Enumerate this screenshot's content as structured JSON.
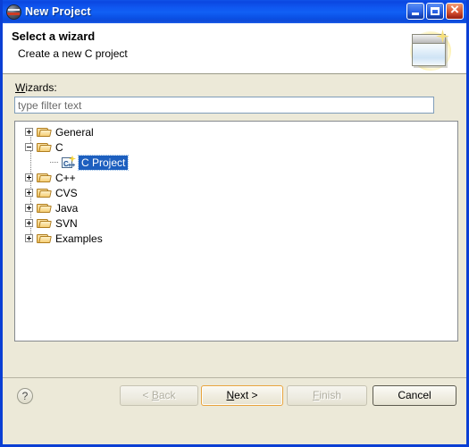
{
  "window": {
    "title": "New Project",
    "app_icon": "eclipse-sphere-icon",
    "controls": {
      "minimize": "minimize-icon",
      "maximize": "maximize-icon",
      "close": "close-icon"
    },
    "border_color": "#0b3fd4",
    "titlebar_color": "#0f56ef",
    "body_color": "#ece9d8"
  },
  "banner": {
    "title": "Select a wizard",
    "subtitle": "Create a new C project",
    "icon": "new-wizard-banner-icon"
  },
  "form": {
    "wizards_label_prefix": "W",
    "wizards_label_rest": "izards:",
    "filter": {
      "value": "type filter text",
      "placeholder": "type filter text"
    }
  },
  "tree": {
    "selection_color": "#1d5fbf",
    "items": [
      {
        "label": "General",
        "level": 0,
        "state": "collapsed",
        "icon": "folder-icon",
        "selected": false
      },
      {
        "label": "C",
        "level": 0,
        "state": "expanded",
        "icon": "folder-icon",
        "selected": false
      },
      {
        "label": "C Project",
        "level": 1,
        "state": "leaf",
        "icon": "c-project-new-icon",
        "selected": true
      },
      {
        "label": "C++",
        "level": 0,
        "state": "collapsed",
        "icon": "folder-icon",
        "selected": false
      },
      {
        "label": "CVS",
        "level": 0,
        "state": "collapsed",
        "icon": "folder-icon",
        "selected": false
      },
      {
        "label": "Java",
        "level": 0,
        "state": "collapsed",
        "icon": "folder-icon",
        "selected": false
      },
      {
        "label": "SVN",
        "level": 0,
        "state": "collapsed",
        "icon": "folder-icon",
        "selected": false
      },
      {
        "label": "Examples",
        "level": 0,
        "state": "collapsed",
        "icon": "folder-icon",
        "selected": false
      }
    ]
  },
  "buttons": {
    "help": "?",
    "back": "< Back",
    "back_mnemonic": "B",
    "next": "Next >",
    "next_mnemonic": "N",
    "finish": "Finish",
    "finish_mnemonic": "F",
    "cancel": "Cancel",
    "default_button": "next",
    "disabled": [
      "back",
      "finish"
    ],
    "default_border_color": "#e8a33d"
  }
}
